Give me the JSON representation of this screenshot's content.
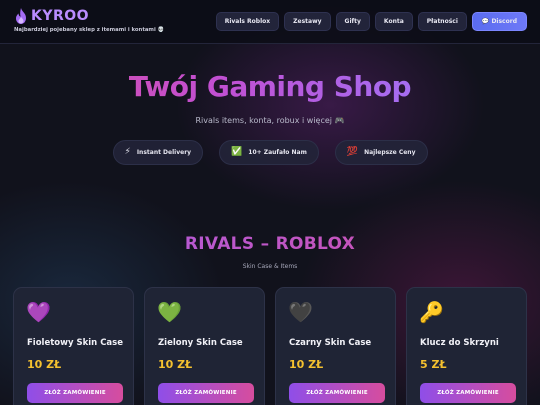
{
  "brand": {
    "logo": "KYROO",
    "tagline": "Najbardziej pojebany sklep z itemami i kontami 💀",
    "icon": "flame-icon",
    "color": "#b98cff"
  },
  "nav": [
    {
      "label": "Rivals Roblox"
    },
    {
      "label": "Zestawy"
    },
    {
      "label": "Gifty"
    },
    {
      "label": "Konta"
    },
    {
      "label": "Płatności"
    },
    {
      "label": "💬 Discord",
      "accent": "#5a6cf0"
    }
  ],
  "hero": {
    "title": "Twój Gaming Shop",
    "subtitle": "Rivals items, konta, robux i więcej 🎮",
    "features": [
      {
        "icon": "⚡",
        "label": "Instant Delivery"
      },
      {
        "icon": "✅",
        "label": "10+ Zaufało Nam"
      },
      {
        "icon": "💯",
        "label": "Najlepsze Ceny"
      }
    ]
  },
  "section": {
    "title": "RIVALS – ROBLOX",
    "subtitle": "Skin Case & Items"
  },
  "products": [
    {
      "emoji": "💜",
      "name": "Fioletowy Skin Case",
      "price": "10 ZŁ",
      "button": "ZŁÓŻ ZAMÓWIENIE"
    },
    {
      "emoji": "💚",
      "name": "Zielony Skin Case",
      "price": "10 ZŁ",
      "button": "ZŁÓŻ ZAMÓWIENIE"
    },
    {
      "emoji": "🖤",
      "name": "Czarny Skin Case",
      "price": "10 ZŁ",
      "button": "ZŁÓŻ ZAMÓWIENIE"
    },
    {
      "emoji": "🔑",
      "name": "Klucz do Skrzyni",
      "price": "5 ZŁ",
      "button": "ZŁÓŻ ZAMÓWIENIE"
    }
  ],
  "colors": {
    "price": "#f4c12f",
    "button_gradient_start": "#8f4ee8",
    "button_gradient_end": "#d64d9e",
    "background": "#11121c"
  }
}
